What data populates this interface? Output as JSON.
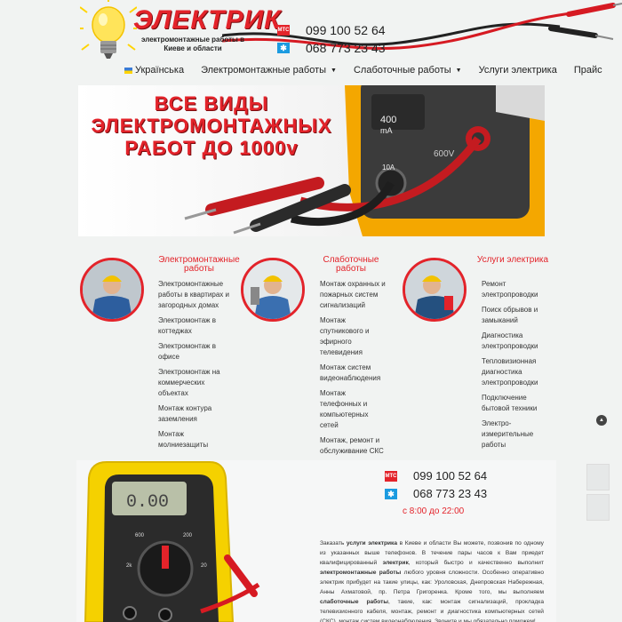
{
  "header": {
    "logo_title": "ЭЛЕКТРИК",
    "logo_subtitle": "электромонтажные работы в Киеве и области",
    "phones": [
      {
        "operator": "МТС",
        "number": "099 100 52 64"
      },
      {
        "operator": "Киевстар",
        "number": "068 773 23 43"
      }
    ]
  },
  "nav": {
    "items": [
      {
        "label": "Українська",
        "dropdown": false,
        "flag": true
      },
      {
        "label": "Электромонтажные работы",
        "dropdown": true
      },
      {
        "label": "Слаботочные работы",
        "dropdown": true
      },
      {
        "label": "Услуги электрика",
        "dropdown": false
      },
      {
        "label": "Прайс",
        "dropdown": false
      }
    ]
  },
  "banner": {
    "line1": "ВСЕ ВИДЫ",
    "line2": "ЭЛЕКТРОМОНТАЖНЫХ",
    "line3": "РАБОТ ДО 1000v"
  },
  "services": [
    {
      "title": "Электромонтажные работы",
      "items": [
        "Электромонтажные работы в квартирах и загородных домах",
        "Электромонтаж в коттеджах",
        "Электромонтаж в офисе",
        "Электромонтаж на коммерческих объектах",
        "Монтаж контура заземления",
        "Монтаж молниезащиты"
      ]
    },
    {
      "title": "Слаботочные работы",
      "items": [
        "Монтаж охранных и пожарных систем сигнализаций",
        "Монтаж спутникового и эфирного телевидения",
        "Монтаж систем видеонаблюдения",
        "Монтаж телефонных и компьютерных сетей",
        "Монтаж, ремонт и обслуживание СКС"
      ]
    },
    {
      "title": "Услуги электрика",
      "items": [
        "Ремонт электропроводки",
        "Поиск обрывов и замыканий",
        "Диагностика электропроводки",
        "Тепловизионная диагностика электропроводки",
        "Подключение бытовой техники",
        "Электро-измерительные работы"
      ]
    }
  ],
  "contact": {
    "phone1": "099 100 52 64",
    "phone2": "068 773 23 43",
    "hours": "с 8:00 до 22:00"
  },
  "description": {
    "p1": "Заказать",
    "b1": "услуги электрика",
    "p2": "в Киеве и области Вы можете, позвонив по одному из указанных выше телефонов. В течение пары часов к Вам приедет квалифицированный",
    "b2": "электрик",
    "p3": ", который быстро и качественно выполнит",
    "b3": "электромонтажные работы",
    "p4": "любого уровня сложности. Особенно оперативно электрик прибудет на такие улицы, как: Уроловская, Днепровская Набережная, Анны Ахматовой, пр. Петра Григоренка. Кроме того, мы выполняем",
    "b4": "слаботочные работы",
    "p5": ", такие, как: монтаж сигнализаций, прокладка телевизионного кабеля, монтаж, ремонт и диагностика компьютерных сетей (СКС), монтаж систем видеонаблюдения. Звоните и мы обязательно поможем!"
  },
  "colors": {
    "accent": "#e3232a",
    "background": "#f1f3f2",
    "mts": "#e3232a",
    "kyivstar": "#1b9be0"
  }
}
